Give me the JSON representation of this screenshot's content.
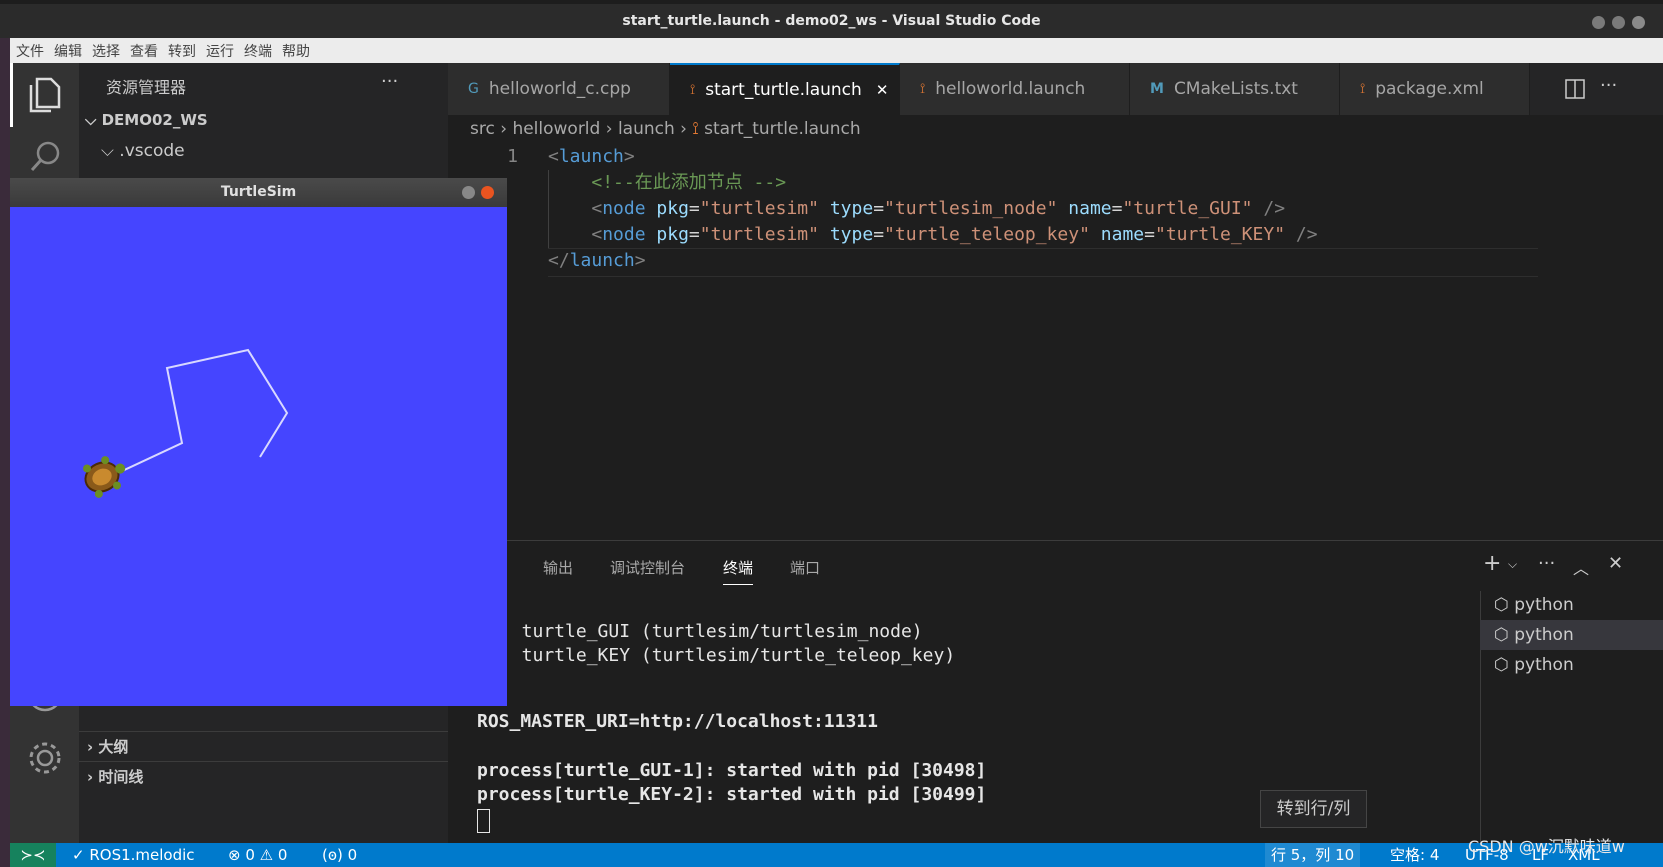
{
  "window": {
    "title": "start_turtle.launch - demo02_ws - Visual Studio Code"
  },
  "menu": [
    "文件",
    "编辑",
    "选择",
    "查看",
    "转到",
    "运行",
    "终端",
    "帮助"
  ],
  "sidebar": {
    "title": "资源管理器",
    "more": "···",
    "root": "DEMO02_WS",
    "folder": ".vscode",
    "outline": "大纲",
    "timeline": "时间线"
  },
  "tabs": [
    {
      "label": "helloworld_c.cpp",
      "icon": "cpp-icon",
      "icon_glyph": "G"
    },
    {
      "label": "start_turtle.launch",
      "icon": "rss-icon",
      "icon_glyph": "⟟",
      "active": true,
      "close": "✕"
    },
    {
      "label": "helloworld.launch",
      "icon": "rss-icon",
      "icon_glyph": "⟟"
    },
    {
      "label": "CMakeLists.txt",
      "icon": "cmake-icon",
      "icon_glyph": "M"
    },
    {
      "label": "package.xml",
      "icon": "rss-icon",
      "icon_glyph": "⟟"
    }
  ],
  "breadcrumb": [
    "src",
    "helloworld",
    "launch",
    "start_turtle.launch"
  ],
  "editor": {
    "line_no": "1",
    "lines": {
      "l1_open": "<",
      "l1_tag": "launch",
      "l1_close": ">",
      "l2_comment": "<!--在此添加节点 -->",
      "l3_open": "<",
      "l3_tag": "node",
      "l3_a1": "pkg",
      "l3_v1": "\"turtlesim\"",
      "l3_a2": "type",
      "l3_v2": "\"turtlesim_node\"",
      "l3_a3": "name",
      "l3_v3": "\"turtle_GUI\"",
      "l3_end": "/>",
      "l4_open": "<",
      "l4_tag": "node",
      "l4_a1": "pkg",
      "l4_v1": "\"turtlesim\"",
      "l4_a2": "type",
      "l4_v2": "\"turtle_teleop_key\"",
      "l4_a3": "name",
      "l4_v3": "\"turtle_KEY\"",
      "l4_end": "/>",
      "l5_open": "</",
      "l5_tag": "launch",
      "l5_close": ">"
    }
  },
  "panel": {
    "tabs": [
      "输出",
      "调试控制台",
      "终端",
      "端口"
    ],
    "active_tab": "终端",
    "terminal": [
      "  turtle_GUI (turtlesim/turtlesim_node)",
      "  turtle_KEY (turtlesim/turtle_teleop_key)",
      "ROS_MASTER_URI=http://localhost:11311",
      "process[turtle_GUI-1]: started with pid [30498]",
      "process[turtle_KEY-2]: started with pid [30499]"
    ],
    "terminals": [
      "python",
      "python",
      "python"
    ]
  },
  "turtlesim": {
    "title": "TurtleSim",
    "bg": "#4545ff"
  },
  "tooltip": "转到行/列",
  "status": {
    "branch": "✓ ROS1.melodic",
    "errors": "⊗ 0 ⚠ 0",
    "ports": "(ꙩ) 0",
    "position": "行 5，列 10",
    "spaces": "空格: 4",
    "encoding": "UTF-8",
    "eol": "LF",
    "lang": "XML",
    "watermark": "CSDN @w沉默味道w"
  },
  "colors": {
    "accent": "#007acc",
    "editor_bg": "#1e1e1e",
    "sidebar_bg": "#252526"
  }
}
